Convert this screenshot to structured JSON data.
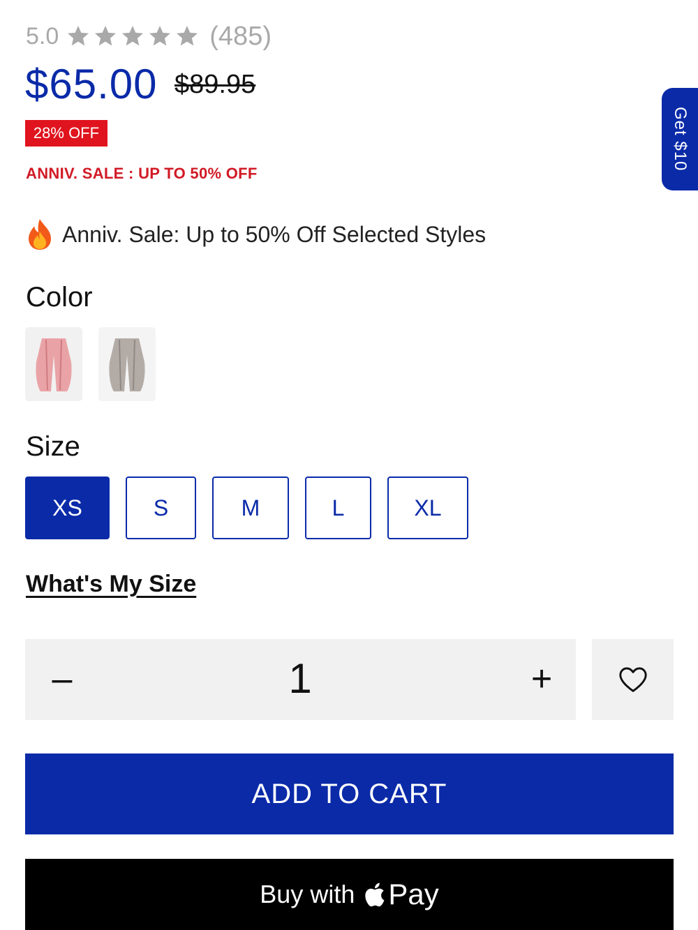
{
  "rating": {
    "score": "5.0",
    "stars": 5,
    "count": "(485)"
  },
  "price": {
    "current": "$65.00",
    "compare_at": "$89.95"
  },
  "discount_badge": "28% OFF",
  "sale_line": "ANNIV. SALE : UP TO 50% OFF",
  "promo": {
    "icon": "fire-icon",
    "text": "Anniv. Sale: Up to 50% Off Selected Styles"
  },
  "color": {
    "label": "Color",
    "swatches": [
      "pink",
      "grey"
    ]
  },
  "size": {
    "label": "Size",
    "options": [
      "XS",
      "S",
      "M",
      "L",
      "XL"
    ],
    "selected": "XS"
  },
  "size_guide_link": "What's My Size",
  "quantity": {
    "minus": "–",
    "value": "1",
    "plus": "+"
  },
  "wishlist_icon": "heart-icon",
  "add_to_cart": "ADD TO CART",
  "apple_pay": {
    "prefix": "Buy with",
    "word": "Pay"
  },
  "side_tab": "Get $10",
  "colors": {
    "accent": "#0a2aa8",
    "sale_red": "#e0141e",
    "star_grey": "#a9a9a9"
  }
}
